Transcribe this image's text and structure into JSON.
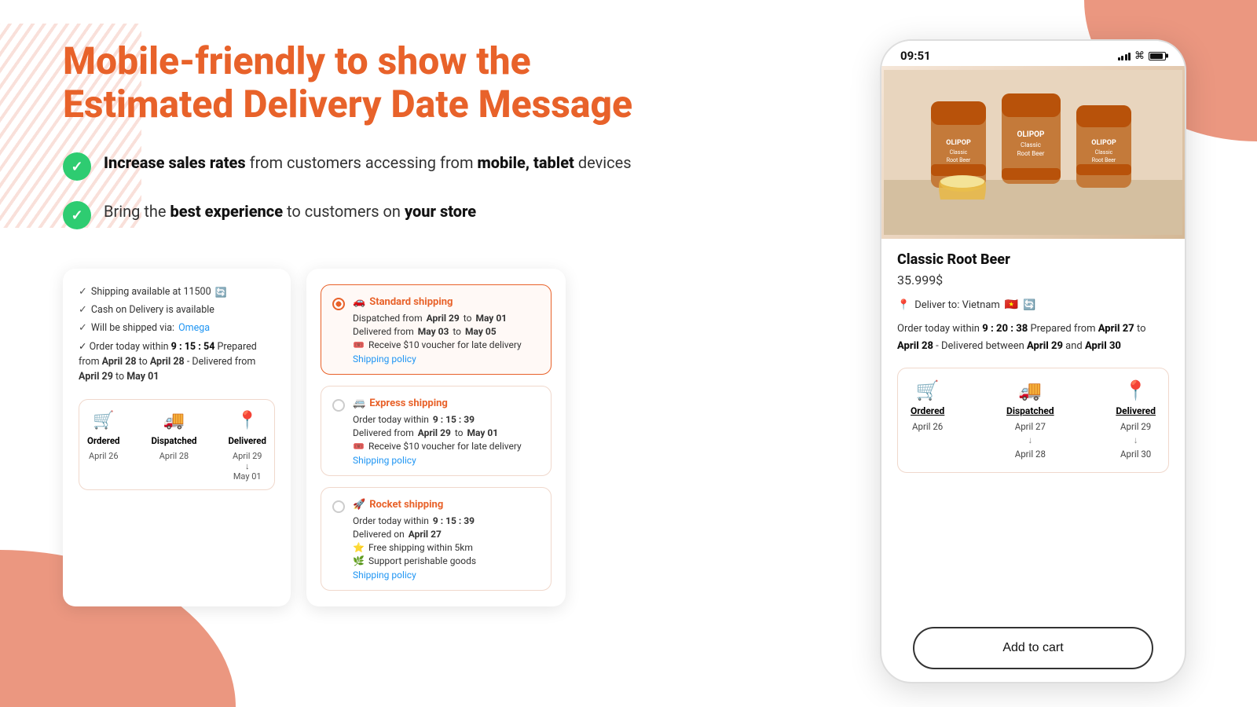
{
  "page": {
    "title": "Mobile-friendly to show the",
    "title2": "Estimated Delivery Date Message"
  },
  "bullets": [
    {
      "id": "bullet-1",
      "text_bold": "Increase sales rates",
      "text_normal": " from customers accessing from ",
      "text_bold2": "mobile, tablet",
      "text_normal2": " devices"
    },
    {
      "id": "bullet-2",
      "text_normal": "Bring the ",
      "text_bold": "best experience",
      "text_normal2": " to customers on ",
      "text_bold2": "your store"
    }
  ],
  "card_shipping": {
    "line1": "Shipping available at 11500",
    "line2": "Cash on Delivery is available",
    "line3": "Will be shipped via:",
    "line3_link": "Omega",
    "order_info": "Order today within",
    "time": "9 : 15 : 54",
    "prepared": "Prepared from",
    "from_date": "April 28",
    "to_date": "April 28",
    "delivered": "Delivered from",
    "del_from": "April 29",
    "del_to": "May 01",
    "steps": [
      {
        "icon": "🛒",
        "label": "Ordered",
        "date": "April 26"
      },
      {
        "icon": "🚚",
        "label": "Dispatched",
        "date": "April 28"
      },
      {
        "icon": "📍",
        "label": "Delivered",
        "date": "April 29",
        "date2": "May 01"
      }
    ]
  },
  "card_options": {
    "options": [
      {
        "icon": "🚗",
        "title": "Standard shipping",
        "dispatched": "Dispatched from",
        "dispatch_from": "April 29",
        "dispatch_to": "May 01",
        "delivered_from": "May 03",
        "delivered_to": "May 05",
        "voucher": "Receive $10 voucher for late delivery",
        "policy_link": "Shipping policy",
        "selected": true
      },
      {
        "icon": "🚐",
        "title": "Express shipping",
        "order_info": "Order today within",
        "time": "9 : 15 : 39",
        "delivered_from": "April 29",
        "delivered_to": "May 01",
        "voucher": "Receive $10 voucher for late delivery",
        "policy_link": "Shipping policy",
        "selected": false
      },
      {
        "icon": "🚀",
        "title": "Rocket shipping",
        "order_info": "Order today within",
        "time": "9 : 15 : 39",
        "delivered_on": "April 27",
        "free_shipping": "Free shipping within 5km",
        "perishable": "Support perishable goods",
        "policy_link": "Shipping policy",
        "selected": false
      }
    ]
  },
  "phone": {
    "status_time": "09:51",
    "product_name": "Classic Root Beer",
    "product_price": "35.999$",
    "deliver_to": "Deliver to: Vietnam",
    "order_info_prefix": "Order today within",
    "order_time": "9 : 20 : 38",
    "prepared": "Prepared from",
    "prepared_from": "April 27",
    "prepared_to": "April 28",
    "delivered_between": "Delivered between",
    "delivered_from": "April 29",
    "delivered_to": "April 30",
    "steps": [
      {
        "label": "Ordered",
        "date": "April 26"
      },
      {
        "label": "Dispatched",
        "date": "April 27",
        "date2": "April 28"
      },
      {
        "label": "Delivered",
        "date": "April 29",
        "date2": "April 30"
      }
    ],
    "add_to_cart": "Add to cart"
  }
}
